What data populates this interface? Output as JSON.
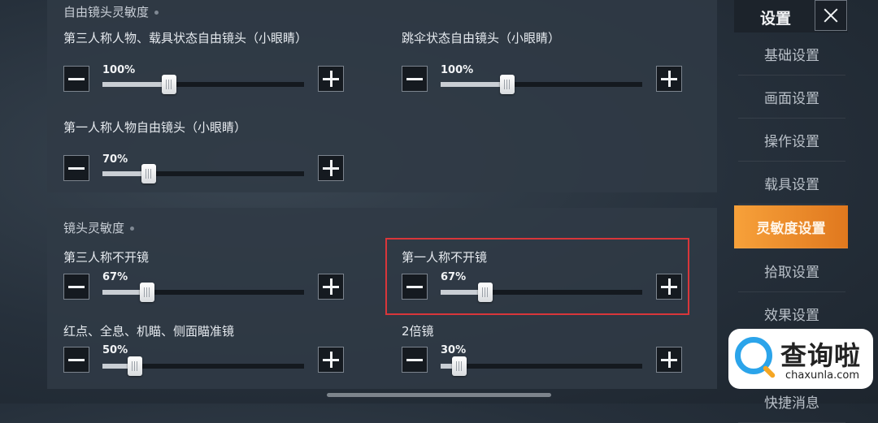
{
  "sections": {
    "free_camera": {
      "title": "自由镜头灵敏度",
      "rows": [
        {
          "label": "第三人称人物、载具状态自由镜头（小眼睛）",
          "value": "100%"
        },
        {
          "label": "跳伞状态自由镜头（小眼睛）",
          "value": "100%"
        },
        {
          "label": "第一人称人物自由镜头（小眼睛）",
          "value": "70%"
        }
      ]
    },
    "lens": {
      "title": "镜头灵敏度",
      "rows": [
        {
          "label": "第三人称不开镜",
          "value": "67%"
        },
        {
          "label": "第一人称不开镜",
          "value": "67%"
        },
        {
          "label": "红点、全息、机瞄、侧面瞄准镜",
          "value": "50%"
        },
        {
          "label": "2倍镜",
          "value": "30%"
        }
      ]
    }
  },
  "sidebar": {
    "title": "设置",
    "items": [
      "基础设置",
      "画面设置",
      "操作设置",
      "载具设置",
      "灵敏度设置",
      "拾取设置",
      "效果设置",
      "快捷消息"
    ],
    "active": "灵敏度设置"
  },
  "watermark": {
    "cn": "查询啦",
    "en": "chaxunla.com"
  },
  "colors": {
    "accent": "#f09030",
    "highlight": "#d9363a"
  }
}
